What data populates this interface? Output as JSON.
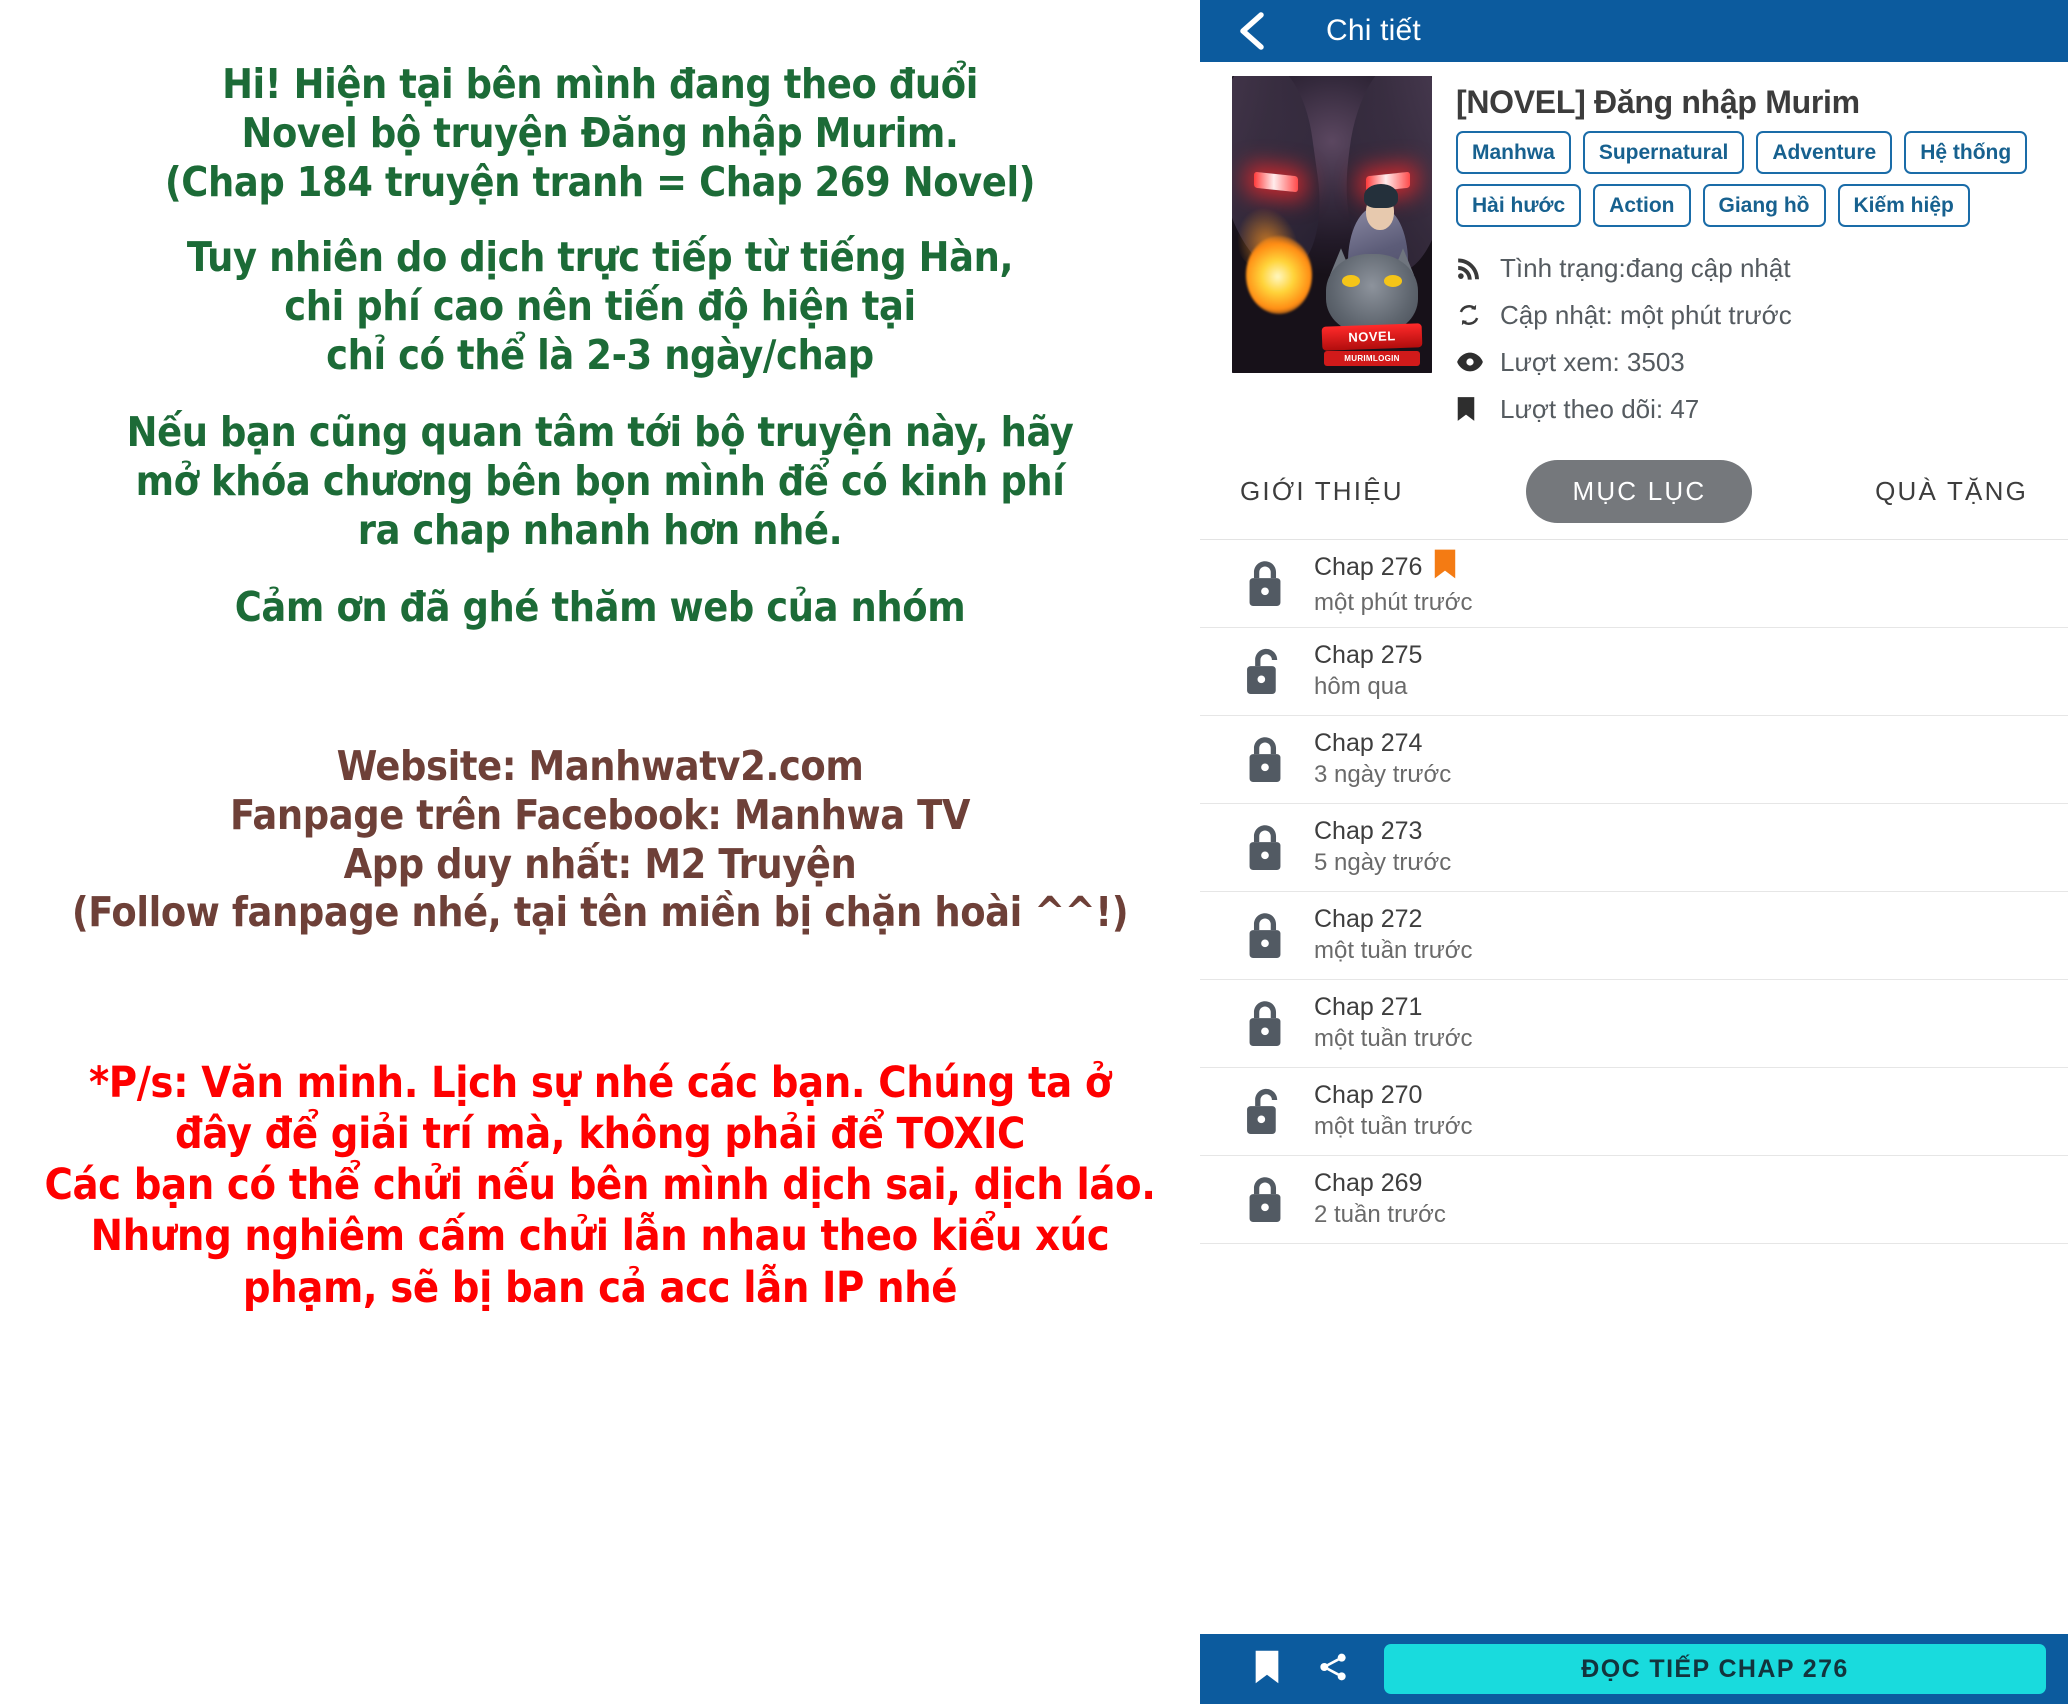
{
  "notice": {
    "green_block_1": "Hi! Hiện tại bên mình đang theo đuổi\nNovel bộ truyện Đăng nhập Murim.\n(Chap 184 truyện tranh = Chap 269 Novel)",
    "green_block_2": "Tuy nhiên do dịch trực tiếp từ tiếng Hàn,\nchi phí cao nên tiến độ hiện tại\nchỉ có thể là 2-3 ngày/chap",
    "green_block_3": "Nếu bạn cũng quan tâm tới bộ truyện này, hãy\nmở khóa chương bên bọn mình để có kinh phí\nra chap nhanh hơn nhé.",
    "green_block_4": "Cảm ơn đã ghé thăm web của nhóm",
    "brown_block": "Website: Manhwatv2.com\nFanpage trên Facebook: Manhwa TV\nApp duy nhất: M2 Truyện\n(Follow fanpage nhé, tại tên miền bị chặn hoài ^^!)",
    "red_block": "*P/s: Văn minh. Lịch sự nhé các bạn. Chúng ta ở\nđây để giải trí mà, không phải để TOXIC\nCác bạn có thể chửi nếu bên mình dịch sai, dịch láo.\nNhưng nghiêm cấm chửi lẫn nhau theo kiểu xúc\nphạm, sẽ bị ban cả acc lẫn IP nhé",
    "colors": {
      "green": "#1c6b37",
      "brown": "#6e4038",
      "red": "#fe0000"
    }
  },
  "app": {
    "header": {
      "title": "Chi tiết",
      "back_icon": "chevron-left-icon",
      "background": "#0c5b9e"
    },
    "book": {
      "title": "[NOVEL] Đăng nhập Murim",
      "cover_logo_primary": "NOVEL",
      "cover_logo_secondary": "MURIMLOGIN",
      "tags": [
        "Manhwa",
        "Supernatural",
        "Adventure",
        "Hệ thống",
        "Hài hước",
        "Action",
        "Giang hồ",
        "Kiếm hiệp"
      ],
      "meta": [
        {
          "icon": "rss-icon",
          "text": "Tình trạng:đang cập nhật"
        },
        {
          "icon": "refresh-icon",
          "text": "Cập nhật: một phút trước"
        },
        {
          "icon": "eye-icon",
          "text": "Lượt xem: 3503"
        },
        {
          "icon": "bookmark-icon",
          "text": "Lượt theo dõi: 47"
        }
      ]
    },
    "tabs": [
      {
        "label": "GIỚI THIỆU",
        "active": false
      },
      {
        "label": "MỤC LỤC",
        "active": true
      },
      {
        "label": "QUÀ TẶNG",
        "active": false
      }
    ],
    "chapters": [
      {
        "name": "Chap 276",
        "time": "một phút trước",
        "locked": true,
        "bookmarked": true
      },
      {
        "name": "Chap 275",
        "time": "hôm qua",
        "locked": false,
        "bookmarked": false
      },
      {
        "name": "Chap 274",
        "time": "3 ngày trước",
        "locked": true,
        "bookmarked": false
      },
      {
        "name": "Chap 273",
        "time": "5 ngày trước",
        "locked": true,
        "bookmarked": false
      },
      {
        "name": "Chap 272",
        "time": "một tuần trước",
        "locked": true,
        "bookmarked": false
      },
      {
        "name": "Chap 271",
        "time": "một tuần trước",
        "locked": true,
        "bookmarked": false
      },
      {
        "name": "Chap 270",
        "time": "một tuần trước",
        "locked": false,
        "bookmarked": false
      },
      {
        "name": "Chap 269",
        "time": "2 tuần trước",
        "locked": true,
        "bookmarked": false
      }
    ],
    "bottom_bar": {
      "bookmark_icon": "bookmark-icon",
      "share_icon": "share-icon",
      "read_button_label": "ĐỌC TIẾP CHAP 276",
      "read_button_color": "#19dbdd",
      "background": "#0c5b9e"
    },
    "accent_colors": {
      "tag_border": "#1a6ca8",
      "bookmark_flag": "#f47b13",
      "active_tab_pill": "#75787c"
    }
  }
}
